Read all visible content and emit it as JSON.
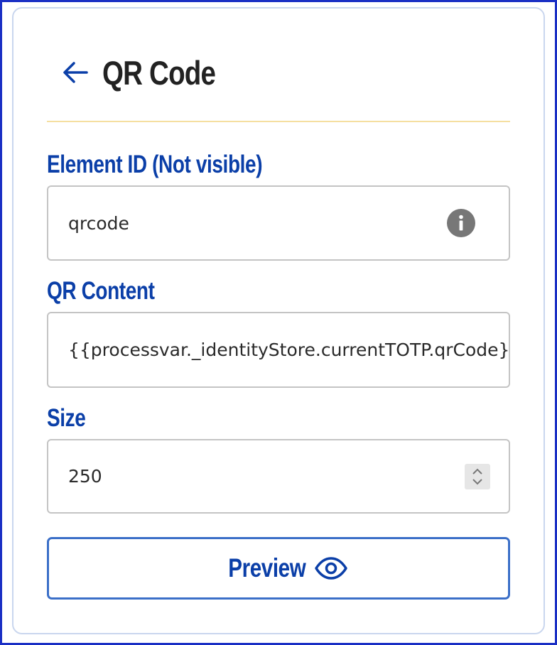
{
  "header": {
    "title": "QR Code",
    "back_icon": "arrow-left-icon"
  },
  "fields": {
    "element_id": {
      "label": "Element ID (Not visible)",
      "value": "qrcode",
      "icon": "info-icon"
    },
    "qr_content": {
      "label": "QR Content",
      "value": "{{processvar._identityStore.currentTOTP.qrCode}}"
    },
    "size": {
      "label": "Size",
      "value": "250",
      "icon": "stepper-icon"
    }
  },
  "preview_button": {
    "label": "Preview",
    "icon": "eye-icon"
  },
  "colors": {
    "accent": "#0b3fa8",
    "divider": "#f5dfa0",
    "frame": "#1a2fc4"
  }
}
